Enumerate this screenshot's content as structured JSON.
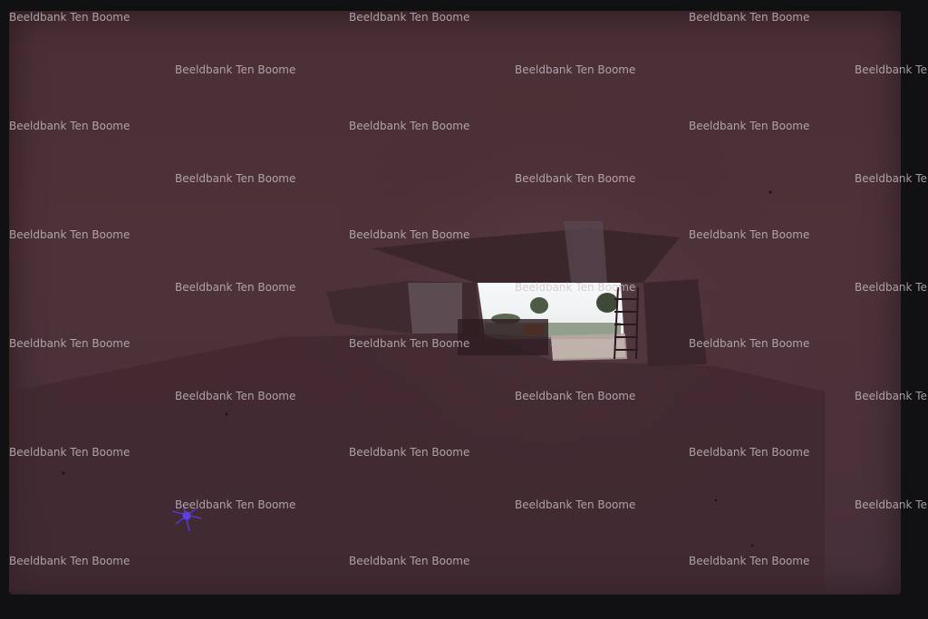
{
  "watermark": {
    "text": "Beeldbank Ten Boome"
  },
  "colors": {
    "frame_background": "#4b3138",
    "border_black": "#111113",
    "opening_sky": "#f2f4f5",
    "watermark_text": "#cdc3c8",
    "light_flare": "#5b3df0"
  },
  "scene": {
    "subject": "tunnel-opening"
  }
}
